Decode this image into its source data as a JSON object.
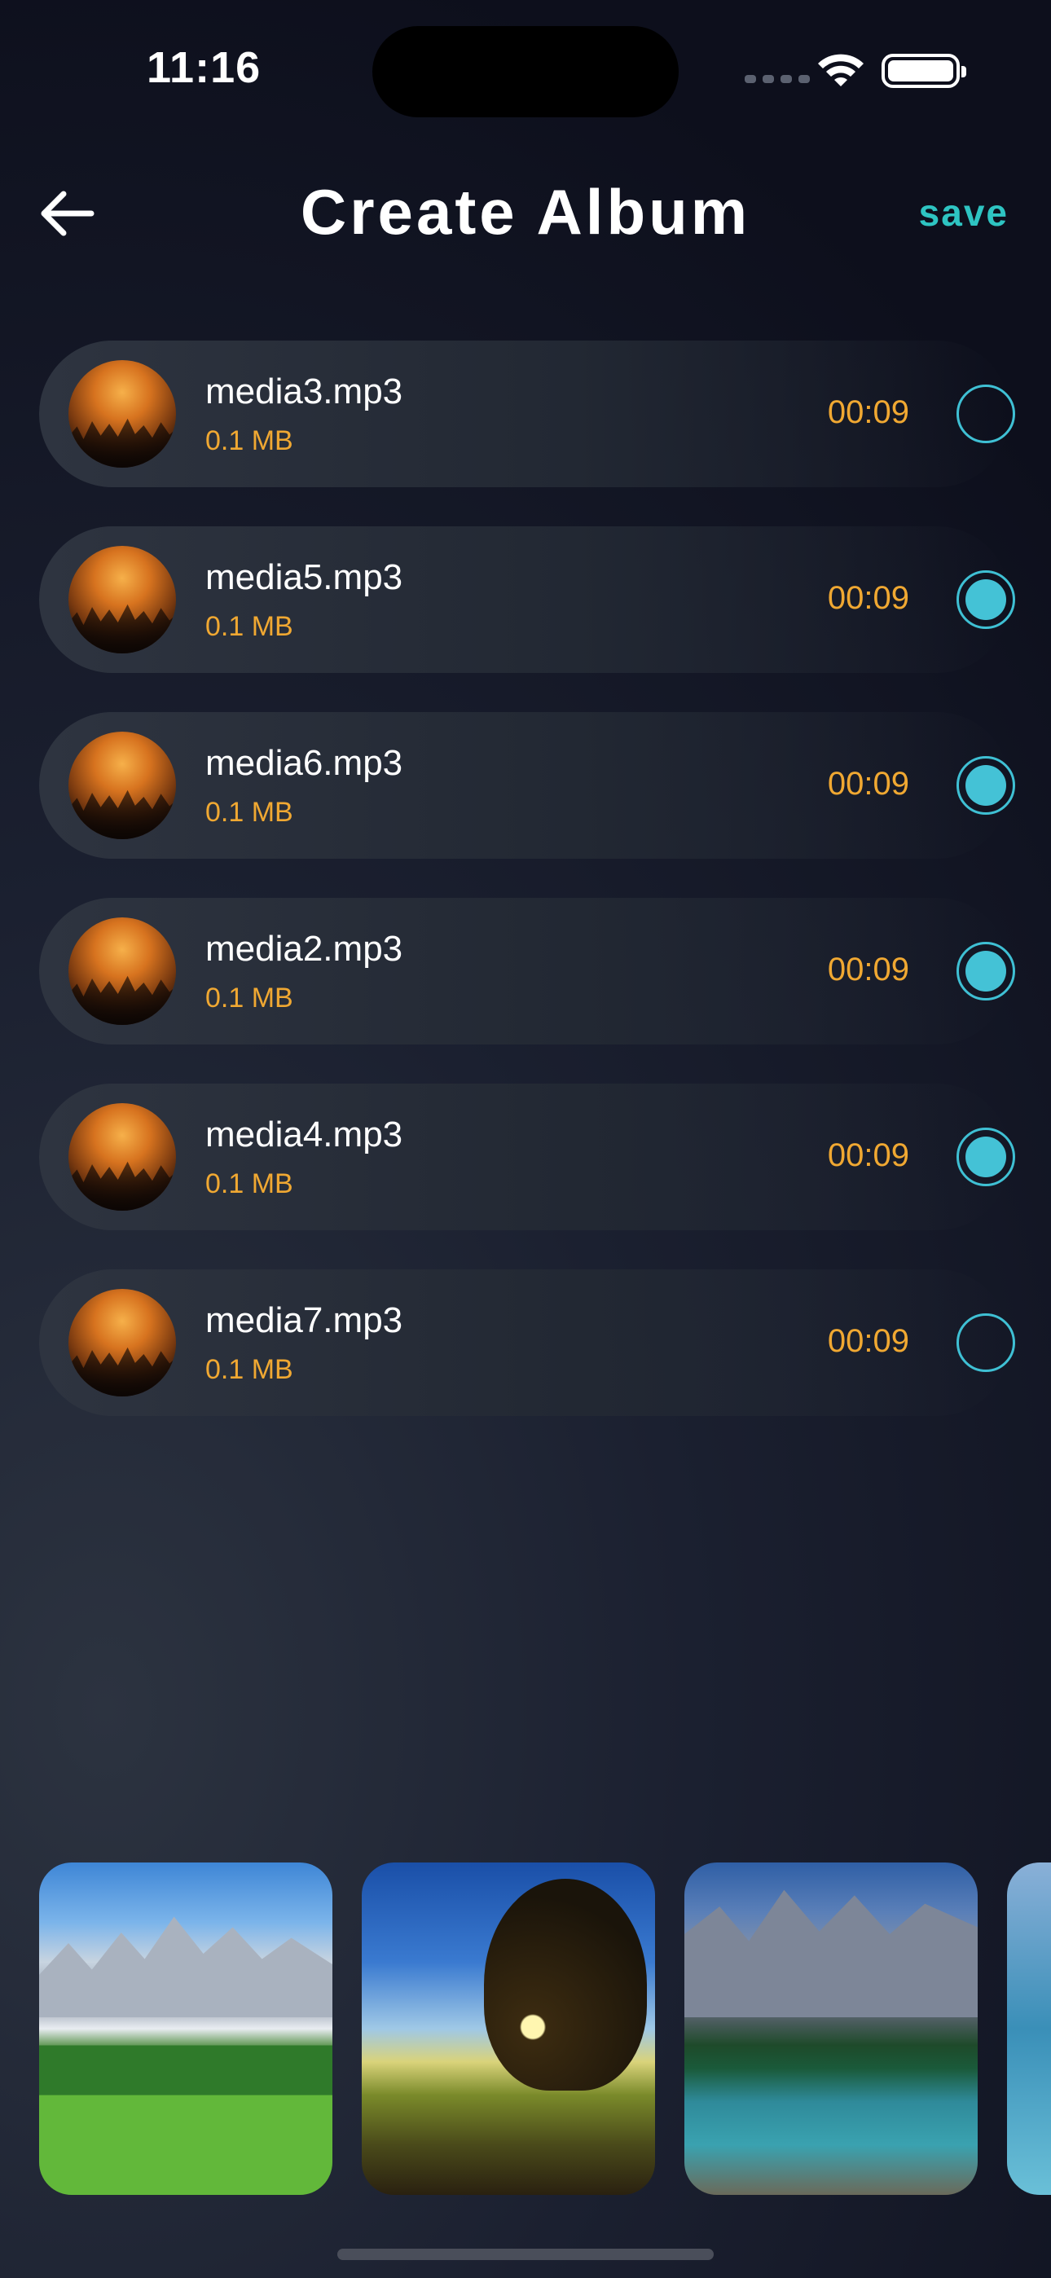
{
  "status_bar": {
    "time": "11:16"
  },
  "header": {
    "title": "Create Album",
    "save_label": "save"
  },
  "media": [
    {
      "name": "media3.mp3",
      "size": "0.1 MB",
      "duration": "00:09",
      "selected": false
    },
    {
      "name": "media5.mp3",
      "size": "0.1 MB",
      "duration": "00:09",
      "selected": true
    },
    {
      "name": "media6.mp3",
      "size": "0.1 MB",
      "duration": "00:09",
      "selected": true
    },
    {
      "name": "media2.mp3",
      "size": "0.1 MB",
      "duration": "00:09",
      "selected": true
    },
    {
      "name": "media4.mp3",
      "size": "0.1 MB",
      "duration": "00:09",
      "selected": true
    },
    {
      "name": "media7.mp3",
      "size": "0.1 MB",
      "duration": "00:09",
      "selected": false
    }
  ],
  "gallery": [
    {
      "icon": "mountain-village-photo"
    },
    {
      "icon": "sunset-road-photo"
    },
    {
      "icon": "mountain-lake-photo"
    },
    {
      "icon": "partial-photo"
    }
  ],
  "colors": {
    "accent": "#2ec4c2",
    "size_text": "#f0a832",
    "radio": "#44c2d6"
  }
}
